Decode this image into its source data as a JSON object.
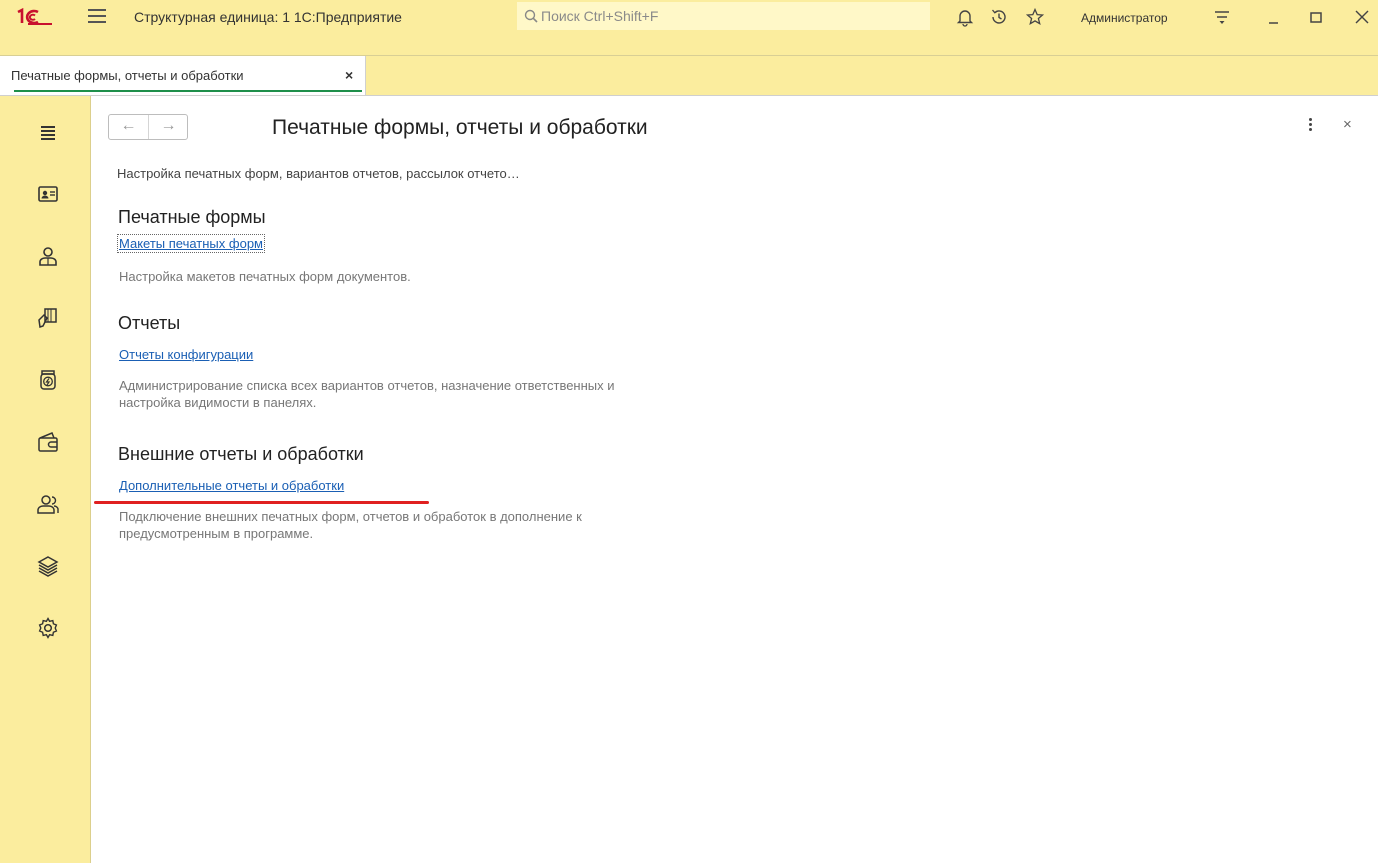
{
  "titlebar": {
    "app_title": "Структурная единица: 1 1С:Предприятие",
    "search_placeholder": "Поиск Ctrl+Shift+F",
    "user": "Администратор",
    "icons": [
      "1c-logo-icon",
      "main-menu-icon",
      "search-icon",
      "bell-icon",
      "history-icon",
      "star-icon",
      "settings-menu-icon",
      "minimize-icon",
      "maximize-icon",
      "close-icon"
    ]
  },
  "tabs": [
    {
      "label": "Печатные формы, отчеты и обработки",
      "close": "×",
      "active": true
    }
  ],
  "sidebar": {
    "icons": [
      "hamburger-icon",
      "id-card-icon",
      "person-icon",
      "hand-cards-icon",
      "energy-jar-icon",
      "wallet-icon",
      "people-icon",
      "layers-icon",
      "gear-icon"
    ]
  },
  "page": {
    "title": "Печатные формы, отчеты и обработки",
    "back": "←",
    "forward": "→",
    "close": "×",
    "subtitle": "Настройка печатных форм, вариантов отчетов, рассылок отчето…",
    "sections": [
      {
        "title": "Печатные формы",
        "link": "Макеты печатных форм",
        "desc": "Настройка макетов печатных форм документов."
      },
      {
        "title": "Отчеты",
        "link": "Отчеты конфигурации",
        "desc": "Администрирование списка всех вариантов отчетов, назначение ответственных и настройка видимости в панелях."
      },
      {
        "title": "Внешние отчеты и обработки",
        "link": "Дополнительные отчеты и обработки",
        "desc": "Подключение внешних печатных форм, отчетов и обработок в дополнение к предусмотренным в программе."
      }
    ]
  },
  "colors": {
    "panel_bg": "#fbed9e",
    "link": "#1a5fb4",
    "tab_underline": "#1e8f4b",
    "highlight": "#e02020"
  }
}
